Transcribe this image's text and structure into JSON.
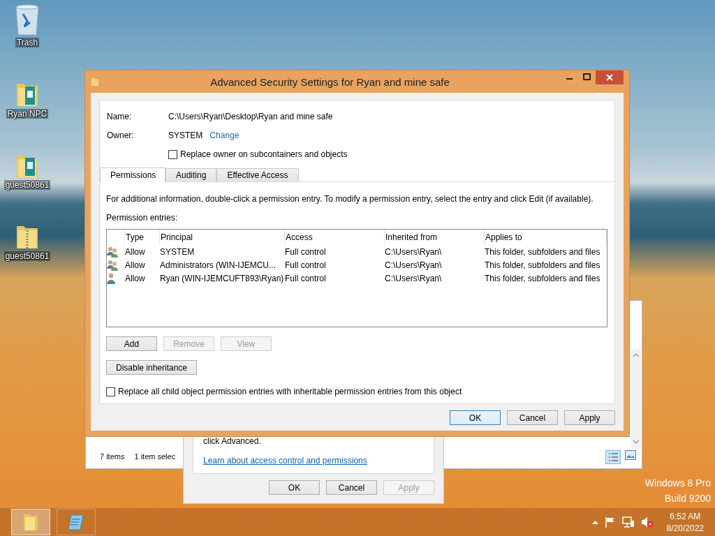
{
  "desktop_icons": [
    {
      "label": "Trash",
      "kind": "trash"
    },
    {
      "label": "Ryan NPC",
      "kind": "folder"
    },
    {
      "label": "guest50861",
      "kind": "folder"
    },
    {
      "label": "guest50861",
      "kind": "zip"
    }
  ],
  "explorer_window": {
    "status_items": "7 items",
    "status_selected": "1 item selec"
  },
  "properties_dialog": {
    "text": "click Advanced.",
    "link": "Learn about access control and permissions",
    "buttons": [
      {
        "label": "OK",
        "disabled": false
      },
      {
        "label": "Cancel",
        "disabled": false
      },
      {
        "label": "Apply",
        "disabled": true
      }
    ]
  },
  "dialog": {
    "title": "Advanced Security Settings for Ryan and mine safe",
    "name_label": "Name:",
    "name_value": "C:\\Users\\Ryan\\Desktop\\Ryan and mine safe",
    "owner_label": "Owner:",
    "owner_value": "SYSTEM",
    "owner_link": "Change",
    "replace_owner": {
      "label": "Replace owner on subcontainers and objects",
      "checked": false
    },
    "tabs": [
      {
        "label": "Permissions",
        "selected": true
      },
      {
        "label": "Auditing",
        "selected": false
      },
      {
        "label": "Effective Access",
        "selected": false
      }
    ],
    "info": "For additional information, double-click a permission entry. To modify a permission entry, select the entry and click Edit (if available).",
    "entries_label": "Permission entries:",
    "columns": [
      "Type",
      "Principal",
      "Access",
      "Inherited from",
      "Applies to"
    ],
    "rows": [
      {
        "kind": "group",
        "type": "Allow",
        "principal": "SYSTEM",
        "access": "Full control",
        "inherited_from": "C:\\Users\\Ryan\\",
        "applies_to": "This folder, subfolders and files"
      },
      {
        "kind": "group",
        "type": "Allow",
        "principal": "Administrators (WIN-IJEMCU...",
        "access": "Full control",
        "inherited_from": "C:\\Users\\Ryan\\",
        "applies_to": "This folder, subfolders and files"
      },
      {
        "kind": "user",
        "type": "Allow",
        "principal": "Ryan (WIN-IJEMCUFT893\\Ryan)",
        "access": "Full control",
        "inherited_from": "C:\\Users\\Ryan\\",
        "applies_to": "This folder, subfolders and files"
      }
    ],
    "entry_buttons": [
      {
        "label": "Add",
        "disabled": false
      },
      {
        "label": "Remove",
        "disabled": true
      },
      {
        "label": "View",
        "disabled": true
      }
    ],
    "disable_inheritance": "Disable inheritance",
    "replace_child": {
      "label": "Replace all child object permission entries with inheritable permission entries from this object",
      "checked": false
    },
    "buttons": [
      {
        "label": "OK",
        "default": true
      },
      {
        "label": "Cancel",
        "default": false
      },
      {
        "label": "Apply",
        "default": false
      }
    ]
  },
  "os_edition": [
    "Windows 8 Pro",
    "Build 9200"
  ],
  "taskbar": {
    "apps": [
      {
        "kind": "explorer",
        "selected": true
      },
      {
        "kind": "notepad",
        "selected": false
      }
    ],
    "time": "6:52 AM",
    "date": "8/20/2022"
  }
}
